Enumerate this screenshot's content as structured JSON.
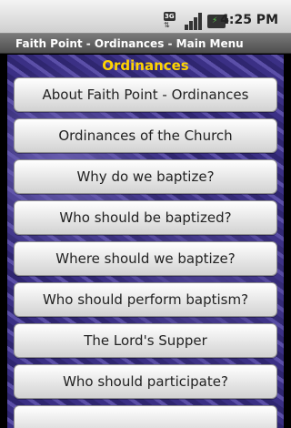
{
  "status_bar": {
    "network_type": "3G",
    "time": "4:25 PM"
  },
  "app": {
    "title": "Faith Point - Ordinances - Main Menu"
  },
  "main": {
    "header": "Ordinances",
    "menu_items": [
      "About Faith Point - Ordinances",
      "Ordinances of the Church",
      "Why do we baptize?",
      "Who should be baptized?",
      "Where should we baptize?",
      "Who should perform baptism?",
      "The Lord's Supper",
      "Who should participate?"
    ]
  },
  "colors": {
    "header_text": "#ffd400",
    "background": "#3f3590"
  }
}
